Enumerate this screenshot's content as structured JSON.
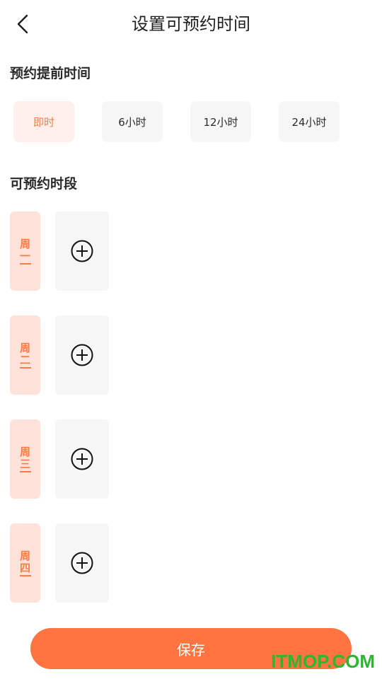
{
  "header": {
    "title": "设置可预约时间",
    "back_icon": "chevron-left-icon"
  },
  "advance": {
    "title": "预约提前时间",
    "options": [
      "即时",
      "6小时",
      "12小时",
      "24小时"
    ],
    "selected": "即时"
  },
  "slots": {
    "title": "可预约时段",
    "days": [
      {
        "label": "周一",
        "add_icon": "plus-circle-icon"
      },
      {
        "label": "周二",
        "add_icon": "plus-circle-icon"
      },
      {
        "label": "周三",
        "add_icon": "plus-circle-icon"
      },
      {
        "label": "周四",
        "add_icon": "plus-circle-icon"
      }
    ]
  },
  "footer": {
    "save_label": "保存"
  },
  "watermark": "ITMOP.COM",
  "colors": {
    "accent": "#ff7440",
    "accent_light": "#ffe3da",
    "selected_bg": "#fff0eb",
    "tile_bg": "#f6f6f6",
    "watermark": "#2fb52f"
  }
}
